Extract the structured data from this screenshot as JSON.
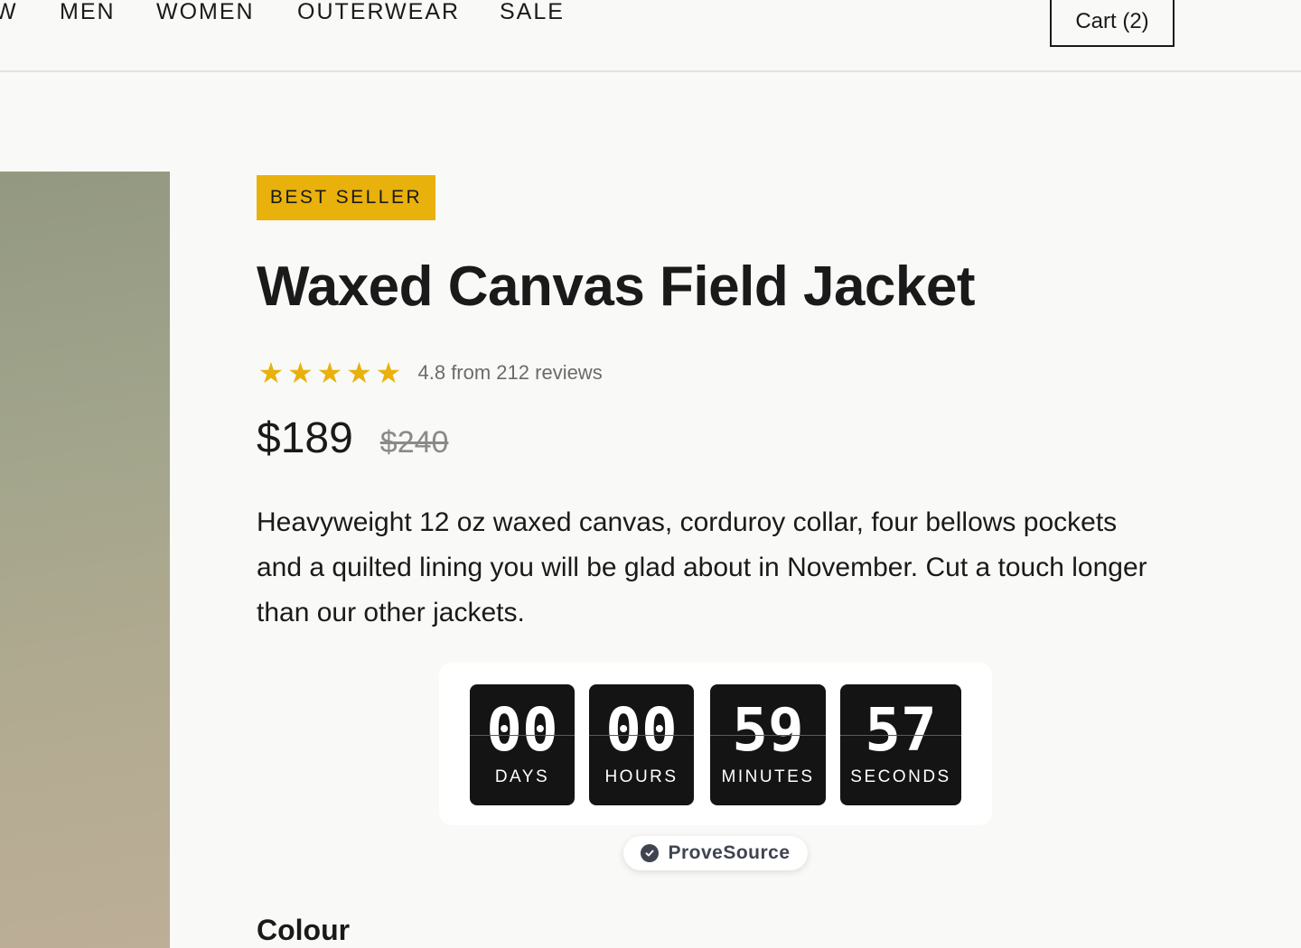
{
  "nav": {
    "items": [
      "W",
      "MEN",
      "WOMEN",
      "OUTERWEAR",
      "SALE"
    ],
    "cart_label": "Cart (2)"
  },
  "product": {
    "badge": "BEST SELLER",
    "title": "Waxed Canvas Field Jacket",
    "rating": {
      "stars": 5,
      "text": "4.8 from 212 reviews"
    },
    "price": "$189",
    "old_price": "$240",
    "description": "Heavyweight 12 oz waxed canvas, corduroy collar, four bellows pockets and a quilted lining you will be glad about in November. Cut a touch longer than our other jackets."
  },
  "countdown": {
    "units": [
      {
        "value": "00",
        "label": "DAYS"
      },
      {
        "value": "00",
        "label": "HOURS"
      },
      {
        "value": "59",
        "label": "MINUTES"
      },
      {
        "value": "57",
        "label": "SECONDS"
      }
    ]
  },
  "provesource": {
    "label": "ProveSource",
    "icon": "check-circle-icon"
  },
  "sections": {
    "colour_heading": "Colour"
  },
  "colors": {
    "accent": "#e8b10c",
    "text": "#1a1a1a",
    "background": "#f9f9f7",
    "countdown_box": "#141414"
  }
}
